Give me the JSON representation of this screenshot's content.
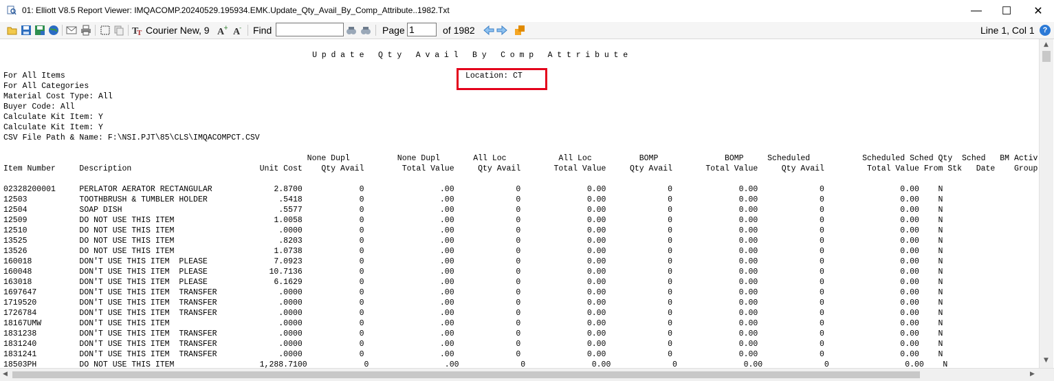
{
  "window": {
    "title": "01: Elliott V8.5 Report Viewer: IMQACOMP.20240529.195934.EMK.Update_Qty_Avail_By_Comp_Attribute..1982.Txt",
    "minimize_glyph": "—",
    "maximize_glyph": "☐",
    "close_glyph": "✕"
  },
  "toolbar": {
    "font_label": "Courier New, 9",
    "find_label": "Find",
    "find_value": "",
    "page_label": "Page",
    "page_value": "1",
    "page_total": "of 1982",
    "cursor_position": "Line 1, Col 1",
    "help_glyph": "?"
  },
  "report": {
    "title": "Update Qty Avail By Comp Attribute",
    "header_lines": "For All Items\nFor All Categories\nMaterial Cost Type: All\nBuyer Code: All\nCalculate Kit Item: Y\nCalculate Kit Item: Y\nCSV File Path & Name: F:\\NSI.PJT\\85\\CLS\\IMQACOMPCT.CSV",
    "location": "Location: CT",
    "column_header_1": "                                                                None Dupl          None Dupl       All Loc           All Loc          BOMP              BOMP     Scheduled           Scheduled Sched Qty  Sched   BM Activ",
    "column_header_2": "Item Number     Description                           Unit Cost    Qty Avail        Total Value     Qty Avail       Total Value     Qty Avail       Total Value     Qty Avail         Total Value From Stk   Date    Group",
    "rows": [
      "02328200001     PERLATOR AERATOR RECTANGULAR             2.8700            0                .00             0              0.00             0              0.00             0                0.00    N",
      "12503           TOOTHBRUSH & TUMBLER HOLDER               .5418            0                .00             0              0.00             0              0.00             0                0.00    N",
      "12504           SOAP DISH                                 .5577            0                .00             0              0.00             0              0.00             0                0.00    N",
      "12509           DO NOT USE THIS ITEM                     1.0058            0                .00             0              0.00             0              0.00             0                0.00    N",
      "12510           DO NOT USE THIS ITEM                      .0000            0                .00             0              0.00             0              0.00             0                0.00    N",
      "13525           DO NOT USE THIS ITEM                      .8203            0                .00             0              0.00             0              0.00             0                0.00    N",
      "13526           DO NOT USE THIS ITEM                     1.0738            0                .00             0              0.00             0              0.00             0                0.00    N",
      "160018          DON'T USE THIS ITEM  PLEASE              7.0923            0                .00             0              0.00             0              0.00             0                0.00    N",
      "160048          DON'T USE THIS ITEM  PLEASE             10.7136            0                .00             0              0.00             0              0.00             0                0.00    N",
      "163018          DON'T USE THIS ITEM  PLEASE              6.1629            0                .00             0              0.00             0              0.00             0                0.00    N",
      "1697647         DON'T USE THIS ITEM  TRANSFER             .0000            0                .00             0              0.00             0              0.00             0                0.00    N",
      "1719520         DON'T USE THIS ITEM  TRANSFER             .0000            0                .00             0              0.00             0              0.00             0                0.00    N",
      "1726784         DON'T USE THIS ITEM  TRANSFER             .0000            0                .00             0              0.00             0              0.00             0                0.00    N",
      "18167UMW        DON'T USE THIS ITEM                       .0000            0                .00             0              0.00             0              0.00             0                0.00    N",
      "1831238         DON'T USE THIS ITEM  TRANSFER             .0000            0                .00             0              0.00             0              0.00             0                0.00    N",
      "1831240         DON'T USE THIS ITEM  TRANSFER             .0000            0                .00             0              0.00             0              0.00             0                0.00    N",
      "1831241         DON'T USE THIS ITEM  TRANSFER             .0000            0                .00             0              0.00             0              0.00             0                0.00    N",
      "18503PH         DO NOT USE THIS ITEM                  1,288.7100            0                .00             0              0.00             0              0.00             0                0.00    N"
    ]
  },
  "colors": {
    "highlight": "#e3001b",
    "toolbar_bg": "#f5f5f5"
  }
}
